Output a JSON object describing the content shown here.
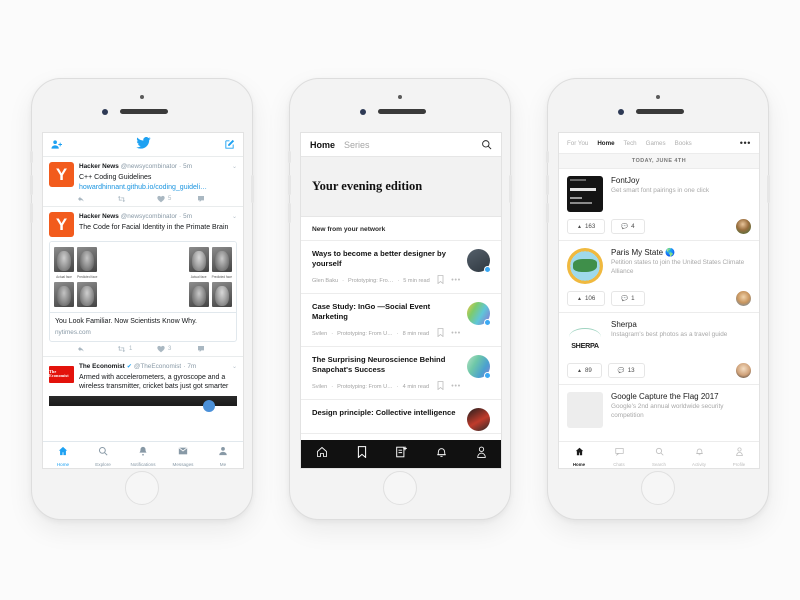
{
  "background_color": "#fbfbfb",
  "phones": [
    {
      "id": "twitter",
      "screen_bg": "#ffffff",
      "topbar": {
        "left_icon": "add-person-icon",
        "center_icon": "twitter-bird-icon",
        "right_icon": "compose-icon",
        "accent": "#1da1f2"
      },
      "tweets": [
        {
          "avatar_letter": "Y",
          "avatar_color": "#f25b1d",
          "name": "Hacker News",
          "handle": "@newsycombinator",
          "time": "5m",
          "verified": false,
          "text": "C++ Coding Guidelines",
          "link": "howardhinnant.github.io/coding_guideli…",
          "actions": {
            "reply": "",
            "retweet": "",
            "like": "5",
            "share": ""
          }
        },
        {
          "avatar_letter": "Y",
          "avatar_color": "#f25b1d",
          "name": "Hacker News",
          "handle": "@newsycombinator",
          "time": "5m",
          "verified": false,
          "text": "The Code for Facial Identity in the Primate Brain",
          "card": {
            "image_labels": [
              "Actual face",
              "Predicted face",
              "Actual face",
              "Predicted face"
            ],
            "title": "You Look Familiar. Now Scientists Know Why.",
            "domain": "nytimes.com"
          },
          "actions": {
            "reply": "",
            "retweet": "1",
            "like": "3",
            "share": ""
          }
        },
        {
          "avatar_letter": "The Economist",
          "avatar_color": "#e3120b",
          "name": "The Economist",
          "handle": "@TheEconomist",
          "time": "7m",
          "verified": true,
          "text": "Armed with accelerometers, a gyroscope and a wireless transmitter, cricket bats just got smarter"
        }
      ],
      "tabbar": [
        {
          "icon": "home-icon",
          "label": "Home",
          "active": true
        },
        {
          "icon": "search-icon",
          "label": "Explore",
          "active": false
        },
        {
          "icon": "bell-icon",
          "label": "Notifications",
          "active": false
        },
        {
          "icon": "envelope-icon",
          "label": "Messages",
          "active": false
        },
        {
          "icon": "person-icon",
          "label": "Me",
          "active": false
        }
      ]
    },
    {
      "id": "medium",
      "topbar": {
        "tab_active": "Home",
        "tab_inactive": "Series",
        "search_icon": "search-icon"
      },
      "hero_title": "Your evening edition",
      "section_label": "New from your network",
      "articles": [
        {
          "title": "Ways to become a better designer by yourself",
          "author": "Glen Baku",
          "publication": "Prototyping: Fro…",
          "read_time": "5 min read",
          "bookmark_icon": "bookmark-icon",
          "more_icon": "more-icon"
        },
        {
          "title": "Case Study: InGo —Social Event Marketing",
          "author": "Svilen",
          "publication": "Prototyping: From U…",
          "read_time": "8 min read",
          "bookmark_icon": "bookmark-icon",
          "more_icon": "more-icon"
        },
        {
          "title": "The Surprising Neuroscience Behind Snapchat's Success",
          "author": "Svilen",
          "publication": "Prototyping: From U…",
          "read_time": "4 min read",
          "bookmark_icon": "bookmark-icon",
          "more_icon": "more-icon"
        },
        {
          "title": "Design principle: Collective intelligence",
          "author": "",
          "publication": "",
          "read_time": "",
          "bookmark_icon": "bookmark-icon",
          "more_icon": "more-icon"
        }
      ],
      "tabbar": [
        {
          "icon": "home-icon",
          "active": true
        },
        {
          "icon": "bookmark-icon",
          "active": false
        },
        {
          "icon": "new-story-icon",
          "active": false
        },
        {
          "icon": "bell-icon",
          "active": false
        },
        {
          "icon": "person-icon",
          "active": false
        }
      ],
      "tabbar_bg": "#111111"
    },
    {
      "id": "producthunt",
      "nav": [
        {
          "label": "For You",
          "active": false
        },
        {
          "label": "Home",
          "active": true
        },
        {
          "label": "Tech",
          "active": false
        },
        {
          "label": "Games",
          "active": false
        },
        {
          "label": "Books",
          "active": false
        }
      ],
      "nav_more_icon": "more-icon",
      "date_header": "TODAY, JUNE 4TH",
      "products": [
        {
          "name": "FontJoy",
          "tagline": "Get smart font pairings in one click",
          "upvotes": "163",
          "comments": "4",
          "thumb": "fontjoy-thumb"
        },
        {
          "name": "Paris My State 🌎",
          "tagline": "Petition states to join the United States Climate Alliance",
          "upvotes": "106",
          "comments": "1",
          "thumb": "paris-thumb"
        },
        {
          "name": "Sherpa",
          "tagline": "Instagram's best photos as a travel guide",
          "upvotes": "89",
          "comments": "13",
          "thumb": "sherpa-thumb",
          "thumb_word": "SHERPA"
        },
        {
          "name": "Google Capture the Flag 2017",
          "tagline": "Google's 2nd annual worldwide security competition",
          "upvotes": "",
          "comments": "",
          "thumb": "gray-thumb"
        }
      ],
      "tabbar": [
        {
          "icon": "home-icon",
          "label": "Home",
          "active": true
        },
        {
          "icon": "chats-icon",
          "label": "Chats",
          "active": false
        },
        {
          "icon": "search-icon",
          "label": "Search",
          "active": false
        },
        {
          "icon": "bell-icon",
          "label": "Activity",
          "active": false
        },
        {
          "icon": "person-icon",
          "label": "Profile",
          "active": false
        }
      ]
    }
  ]
}
